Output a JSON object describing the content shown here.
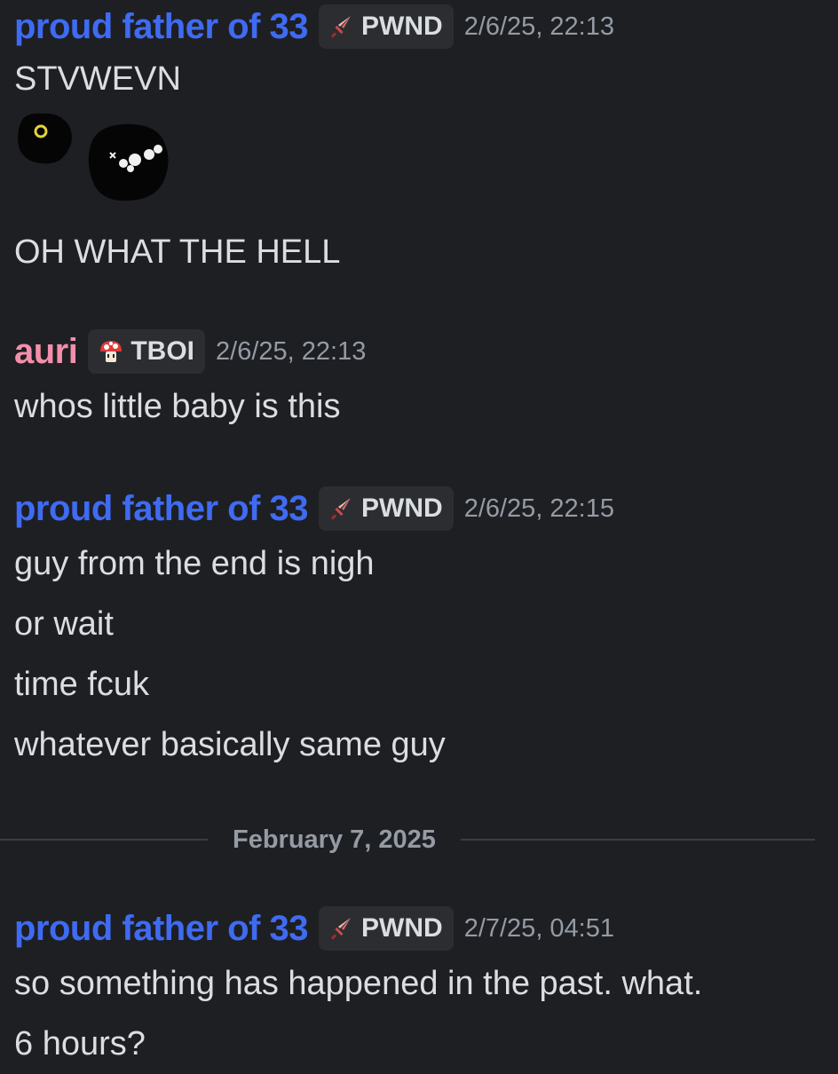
{
  "colors": {
    "background": "#1e1f23",
    "user_proud_father": "#3f6bf3",
    "user_auri": "#f28fab",
    "text": "#dbdee1",
    "muted": "#949ba4",
    "tag_bg": "#2b2d31"
  },
  "messages": [
    {
      "username": "proud father of 33",
      "tag": {
        "icon": "sword-icon",
        "label": "PWND"
      },
      "timestamp": "2/6/25, 22:13",
      "lines": [
        "STVWEVN"
      ],
      "sticker": "two-black-blob-creatures-sticker",
      "lines_after": [
        "OH WHAT THE HELL"
      ]
    },
    {
      "username": "auri",
      "tag": {
        "icon": "mushroom-icon",
        "label": "TBOI"
      },
      "timestamp": "2/6/25, 22:13",
      "lines": [
        "whos little baby is this"
      ]
    },
    {
      "username": "proud father of 33",
      "tag": {
        "icon": "sword-icon",
        "label": "PWND"
      },
      "timestamp": "2/6/25, 22:15",
      "lines": [
        "guy from the end is nigh",
        "or wait",
        "time fcuk",
        "whatever basically same guy"
      ]
    },
    {
      "username": "proud father of 33",
      "tag": {
        "icon": "sword-icon",
        "label": "PWND"
      },
      "timestamp": "2/7/25, 04:51",
      "lines": [
        "so something has happened in the past. what.",
        "6 hours?"
      ]
    }
  ],
  "date_divider": "February 7, 2025"
}
